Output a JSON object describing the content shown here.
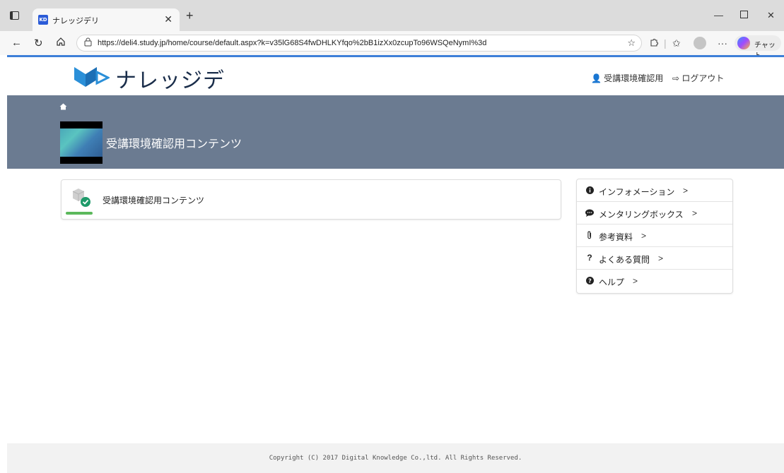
{
  "browser": {
    "tab_title": "ナレッジデリ",
    "tab_favicon": "KD",
    "url": "https://deli4.study.jp/home/course/default.aspx?k=v35lG68S4fwDHLKYfqo%2bB1izXx0zcupTo96WSQeNymI%3d",
    "chat_label": "チャット",
    "icons": [
      "sidebar-toggle-icon",
      "close-icon",
      "plus-icon",
      "minimize-icon",
      "maximize-icon",
      "back-icon",
      "reload-icon",
      "home-icon",
      "lock-icon",
      "star-icon",
      "extensions-icon",
      "favorites-icon",
      "profile-icon",
      "more-icon",
      "copilot-icon"
    ]
  },
  "header": {
    "logo_text": "ナレッジデリ",
    "user_label": "受講環境確認用",
    "logout_label": "ログアウト"
  },
  "banner": {
    "title": "受講環境確認用コンテンツ"
  },
  "course": {
    "title": "受講環境確認用コンテンツ",
    "progress": 1.0,
    "status": "completed"
  },
  "side_menu": {
    "items": [
      {
        "label": "インフォメーション",
        "icon": "info-icon"
      },
      {
        "label": "メンタリングボックス",
        "icon": "chat-bubble-icon"
      },
      {
        "label": "参考資料",
        "icon": "paperclip-icon"
      },
      {
        "label": "よくある質問",
        "icon": "question-icon"
      },
      {
        "label": "ヘルプ",
        "icon": "help-icon"
      }
    ]
  },
  "footer": {
    "copyright": "Copyright (C) 2017 Digital Knowledge Co.,ltd. All Rights Reserved."
  },
  "colors": {
    "banner": "#6b7b91",
    "accent": "#3d7fd8",
    "progress": "#5cb85c",
    "logo_blue": "#2a8fd8"
  }
}
